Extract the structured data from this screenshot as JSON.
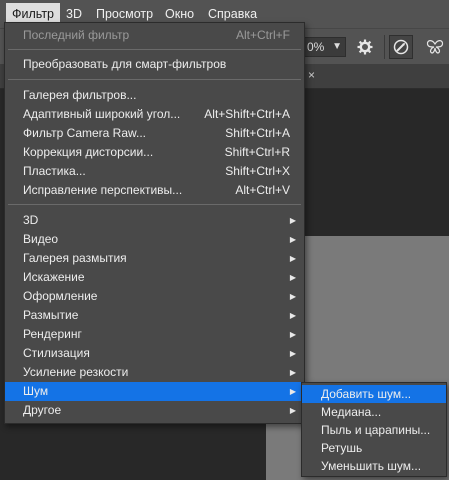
{
  "menubar": {
    "items": [
      {
        "label": "Фильтр",
        "active": true
      },
      {
        "label": "3D",
        "active": false
      },
      {
        "label": "Просмотр",
        "active": false
      },
      {
        "label": "Окно",
        "active": false
      },
      {
        "label": "Справка",
        "active": false
      }
    ]
  },
  "optionsbar": {
    "zoom_value": "0%",
    "icons": [
      "gear-icon",
      "target-icon",
      "butterfly-icon"
    ]
  },
  "tab": {
    "close_glyph": "×"
  },
  "filter_menu": {
    "items": [
      {
        "label": "Последний фильтр",
        "shortcut": "Alt+Ctrl+F",
        "disabled": true
      },
      {
        "label": "Преобразовать для смарт-фильтров",
        "shortcut": ""
      },
      {
        "label": "Галерея фильтров...",
        "shortcut": ""
      },
      {
        "label": "Адаптивный широкий угол...",
        "shortcut": "Alt+Shift+Ctrl+A"
      },
      {
        "label": "Фильтр Camera Raw...",
        "shortcut": "Shift+Ctrl+A"
      },
      {
        "label": "Коррекция дисторсии...",
        "shortcut": "Shift+Ctrl+R"
      },
      {
        "label": "Пластика...",
        "shortcut": "Shift+Ctrl+X"
      },
      {
        "label": "Исправление перспективы...",
        "shortcut": "Alt+Ctrl+V"
      },
      {
        "label": "3D",
        "submenu": true
      },
      {
        "label": "Видео",
        "submenu": true
      },
      {
        "label": "Галерея размытия",
        "submenu": true
      },
      {
        "label": "Искажение",
        "submenu": true
      },
      {
        "label": "Оформление",
        "submenu": true
      },
      {
        "label": "Размытие",
        "submenu": true
      },
      {
        "label": "Рендеринг",
        "submenu": true
      },
      {
        "label": "Стилизация",
        "submenu": true
      },
      {
        "label": "Усиление резкости",
        "submenu": true
      },
      {
        "label": "Шум",
        "submenu": true,
        "highlighted": true
      },
      {
        "label": "Другое",
        "submenu": true
      }
    ]
  },
  "noise_submenu": {
    "items": [
      {
        "label": "Добавить шум...",
        "highlighted": true
      },
      {
        "label": "Медиана..."
      },
      {
        "label": "Пыль и царапины..."
      },
      {
        "label": "Ретушь"
      },
      {
        "label": "Уменьшить шум..."
      }
    ]
  },
  "colors": {
    "highlight": "#1473e6",
    "menu_bg": "#494949",
    "menubar_bg": "#535353"
  }
}
